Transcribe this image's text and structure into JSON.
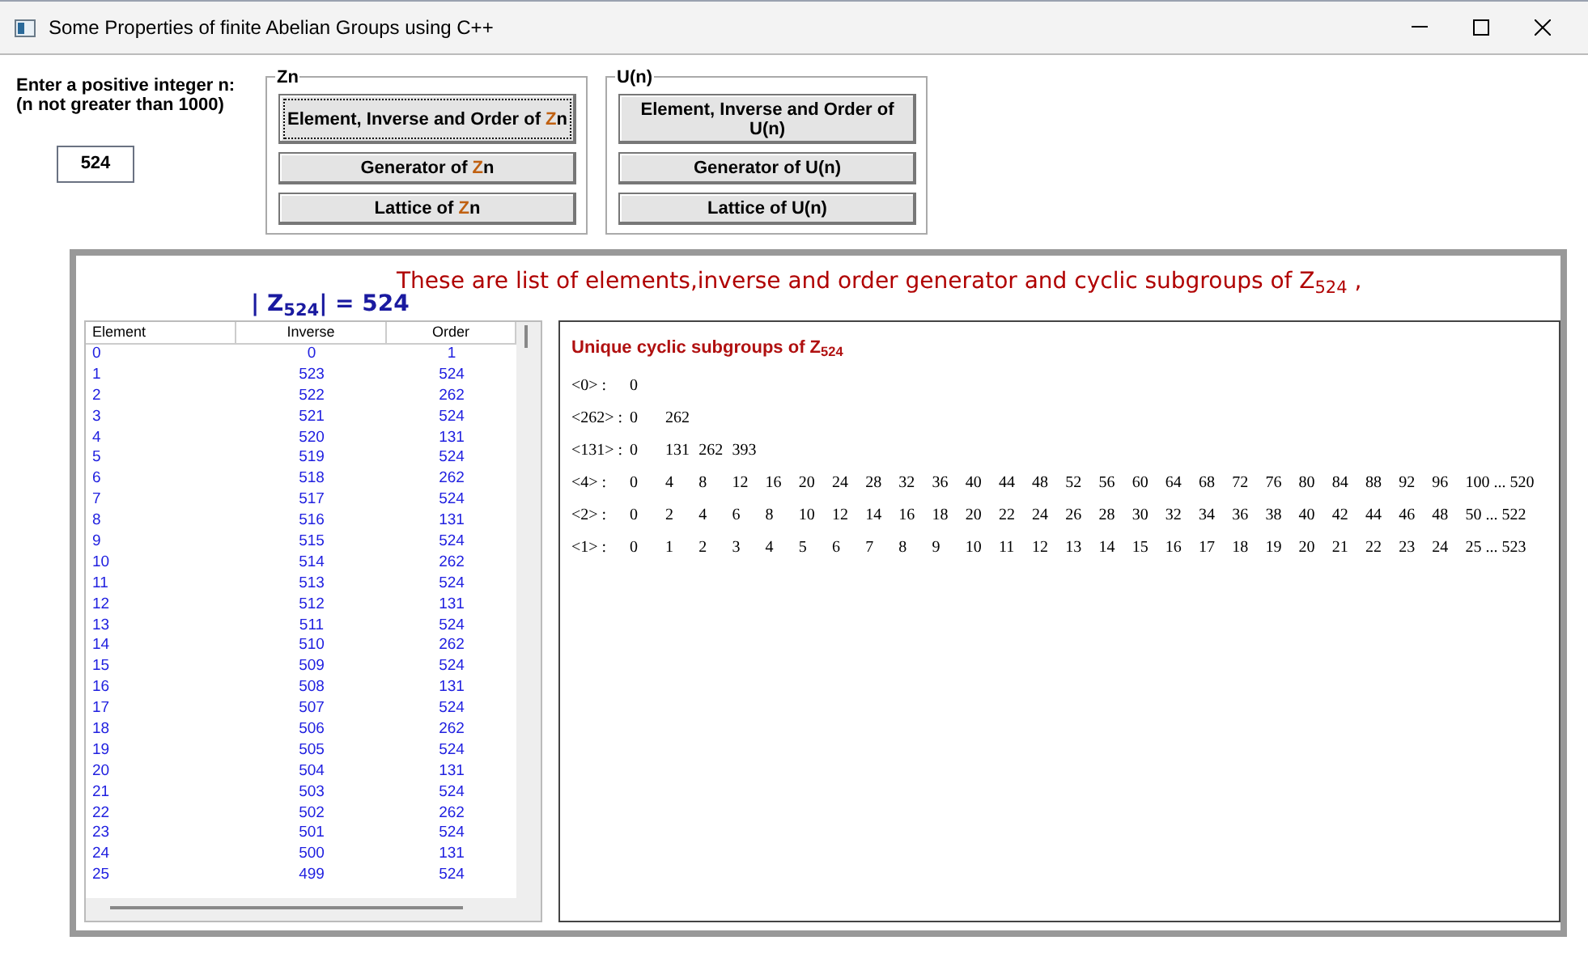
{
  "window": {
    "title": "Some Properties of finite Abelian Groups using C++"
  },
  "prompt": {
    "lines": [
      "Enter a positive integer n:",
      "(n not greater than 1000)"
    ]
  },
  "n_input": {
    "value": "524"
  },
  "groups": [
    {
      "legend": "Zn",
      "buttons": [
        {
          "focused": true,
          "parts": [
            {
              "text": "Element, Inverse and Order of "
            },
            {
              "text": "Z",
              "accent": true
            },
            {
              "text": "n"
            }
          ]
        },
        {
          "focused": false,
          "parts": [
            {
              "text": "Generator of "
            },
            {
              "text": "Z",
              "accent": true
            },
            {
              "text": "n"
            }
          ]
        },
        {
          "focused": false,
          "parts": [
            {
              "text": "Lattice of "
            },
            {
              "text": "Z",
              "accent": true
            },
            {
              "text": "n"
            }
          ]
        }
      ]
    },
    {
      "legend": "U(n)",
      "buttons": [
        {
          "focused": false,
          "parts": [
            {
              "text": "Element, Inverse and Order of U(n)"
            }
          ]
        },
        {
          "focused": false,
          "parts": [
            {
              "text": "Generator of U(n)"
            }
          ]
        },
        {
          "focused": false,
          "parts": [
            {
              "text": "Lattice of U(n)"
            }
          ]
        }
      ]
    }
  ],
  "heading": "These are list of elements,inverse and order generator and cyclic subgroups of Z$_{524}$ ,",
  "order_line": "| Z$_{524}$| = 524",
  "table": {
    "columns": [
      "Element",
      "Inverse",
      "Order"
    ],
    "rows": [
      [
        "0",
        "0",
        "1"
      ],
      [
        "1",
        "523",
        "524"
      ],
      [
        "2",
        "522",
        "262"
      ],
      [
        "3",
        "521",
        "524"
      ],
      [
        "4",
        "520",
        "131"
      ],
      [
        "5",
        "519",
        "524"
      ],
      [
        "6",
        "518",
        "262"
      ],
      [
        "7",
        "517",
        "524"
      ],
      [
        "8",
        "516",
        "131"
      ],
      [
        "9",
        "515",
        "524"
      ],
      [
        "10",
        "514",
        "262"
      ],
      [
        "11",
        "513",
        "524"
      ],
      [
        "12",
        "512",
        "131"
      ],
      [
        "13",
        "511",
        "524"
      ],
      [
        "14",
        "510",
        "262"
      ],
      [
        "15",
        "509",
        "524"
      ],
      [
        "16",
        "508",
        "131"
      ],
      [
        "17",
        "507",
        "524"
      ],
      [
        "18",
        "506",
        "262"
      ],
      [
        "19",
        "505",
        "524"
      ],
      [
        "20",
        "504",
        "131"
      ],
      [
        "21",
        "503",
        "524"
      ],
      [
        "22",
        "502",
        "262"
      ],
      [
        "23",
        "501",
        "524"
      ],
      [
        "24",
        "500",
        "131"
      ],
      [
        "25",
        "499",
        "524"
      ]
    ]
  },
  "subgroups": {
    "title": "Unique cyclic subgroups of Z$_{524}$",
    "rows": [
      {
        "label": "<0> :",
        "values": [
          "0"
        ]
      },
      {
        "label": "<262> :",
        "values": [
          "0",
          "262"
        ]
      },
      {
        "label": "<131> :",
        "values": [
          "0",
          "131",
          "262",
          "393"
        ]
      },
      {
        "label": "<4> :",
        "values": [
          "0",
          "4",
          "8",
          "12",
          "16",
          "20",
          "24",
          "28",
          "32",
          "36",
          "40",
          "44",
          "48",
          "52",
          "56",
          "60",
          "64",
          "68",
          "72",
          "76",
          "80",
          "84",
          "88",
          "92",
          "96",
          "100 ... 520"
        ]
      },
      {
        "label": "<2> :",
        "values": [
          "0",
          "2",
          "4",
          "6",
          "8",
          "10",
          "12",
          "14",
          "16",
          "18",
          "20",
          "22",
          "24",
          "26",
          "28",
          "30",
          "32",
          "34",
          "36",
          "38",
          "40",
          "42",
          "44",
          "46",
          "48",
          "50 ... 522"
        ]
      },
      {
        "label": "<1> :",
        "values": [
          "0",
          "1",
          "2",
          "3",
          "4",
          "5",
          "6",
          "7",
          "8",
          "9",
          "10",
          "11",
          "12",
          "13",
          "14",
          "15",
          "16",
          "17",
          "18",
          "19",
          "20",
          "21",
          "22",
          "23",
          "24",
          "25 ... 523"
        ]
      }
    ]
  }
}
